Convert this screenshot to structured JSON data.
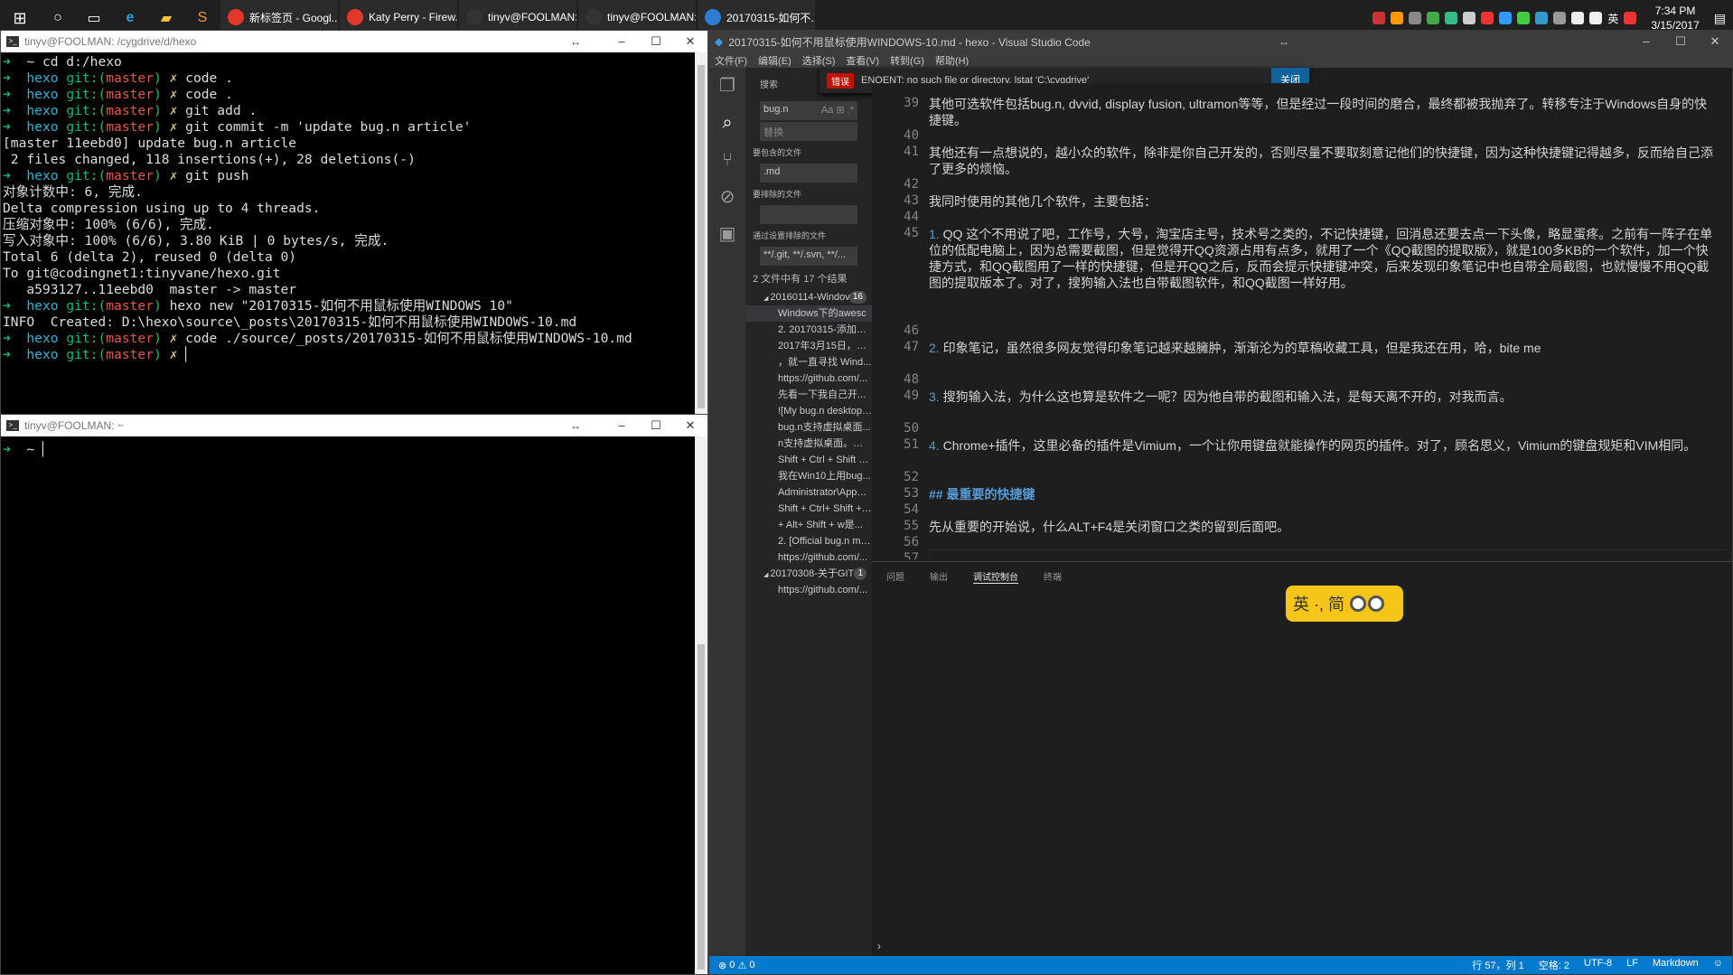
{
  "taskbar": {
    "tasks": [
      {
        "label": "新标签页 - Googl...",
        "color": "#e0392b"
      },
      {
        "label": "Katy Perry - Firew...",
        "color": "#e0392b"
      },
      {
        "label": "tinyv@FOOLMAN:...",
        "color": "#333"
      },
      {
        "label": "tinyv@FOOLMAN:...",
        "color": "#333"
      },
      {
        "label": "20170315-如何不...",
        "color": "#2c7cd6"
      }
    ],
    "tray_text": "英",
    "time": "7:34 PM",
    "date": "3/15/2017"
  },
  "term1": {
    "title": "tinyv@FOOLMAN: /cygdrive/d/hexo"
  },
  "term2": {
    "title": "tinyv@FOOLMAN: ~"
  },
  "vscode": {
    "title": "20170315-如何不用鼠标使用WINDOWS-10.md - hexo - Visual Studio Code",
    "menu": [
      "文件(F)",
      "编辑(E)",
      "选择(S)",
      "查看(V)",
      "转到(G)",
      "帮助(H)"
    ],
    "error": {
      "tag": "错误",
      "msg": "ENOENT: no such file or directory, lstat 'C:\\cygdrive'",
      "close": "关闭"
    },
    "search": {
      "title": "搜索",
      "query": "bug.n",
      "replace": "替换",
      "include_label": "要包含的文件",
      "include": ".md",
      "exclude_label": "要排除的文件",
      "exclude": "",
      "settings_label": "通过设置排除的文件",
      "settings": "**/.git, **/.svn, **/...",
      "summary": "2 文件中有 17 个结果",
      "results": [
        {
          "text": "20160114-Windov",
          "fold": true,
          "badge": "16"
        },
        {
          "text": "Windows下的awesc",
          "sel": true
        },
        {
          "text": "2. 20170315-添加内..."
        },
        {
          "text": "2017年3月15日，放..."
        },
        {
          "text": "，就一直寻找 Wind..."
        },
        {
          "text": "https://github.com/..."
        },
        {
          "text": "先看一下我自己开..."
        },
        {
          "text": "![My bug.n desktop ..."
        },
        {
          "text": "bug.n支持虚拟桌面..."
        },
        {
          "text": "n支持虚拟桌面。Wi..."
        },
        {
          "text": "Shift + Ctrl + Shift +..."
        },
        {
          "text": "我在Win10上用bug..."
        },
        {
          "text": "Administrator\\AppD..."
        },
        {
          "text": "Shift + Ctrl+ Shift + ..."
        },
        {
          "text": "+ Alt+ Shift + w是..."
        },
        {
          "text": "2. [Official bug.n ma..."
        },
        {
          "text": "https://github.com/..."
        },
        {
          "text": "20170308-关于GITI",
          "fold": true,
          "badge": "1"
        },
        {
          "text": "https://github.com/..."
        }
      ]
    },
    "panel_tabs": [
      "问题",
      "输出",
      "调试控制台",
      "终端"
    ],
    "status": {
      "errors": "0",
      "warnings": "0",
      "pos": "行 57，列 1",
      "spaces": "空格: 2",
      "enc": "UTF-8",
      "eol": "LF",
      "lang": "Markdown"
    }
  },
  "ime": {
    "text": "英 ·, 简"
  }
}
